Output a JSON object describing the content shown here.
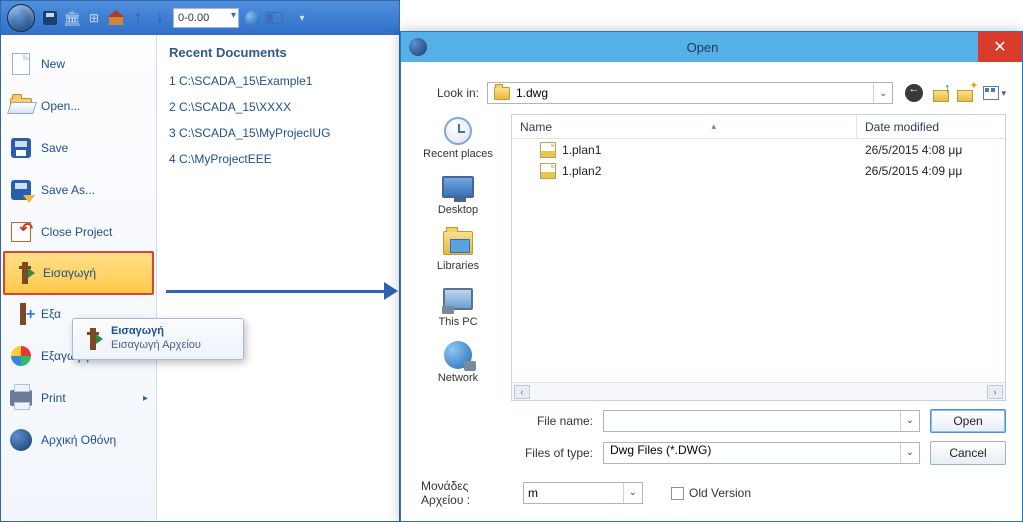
{
  "qat": {
    "combo_value": "0-0.00"
  },
  "menu": {
    "new": "New",
    "open": "Open...",
    "save": "Save",
    "save_as": "Save As...",
    "close_project": "Close Project",
    "import": "Εισαγωγή",
    "export": "Εξα",
    "export_scada": "Εξαγωγή Scadafw",
    "print": "Print",
    "home": "Αρχική Οθόνη"
  },
  "recent": {
    "title": "Recent Documents",
    "items": [
      {
        "idx": "1",
        "path": "C:\\SCADA_15\\Example1"
      },
      {
        "idx": "2",
        "path": "C:\\SCADA_15\\XXXX"
      },
      {
        "idx": "3",
        "path": "C:\\SCADA_15\\MyProjecIUG"
      },
      {
        "idx": "4",
        "path": "C:\\MyProjectEEE"
      }
    ]
  },
  "tooltip": {
    "title": "Εισαγωγή",
    "desc": "Εισαγωγή Αρχείου"
  },
  "dialog": {
    "title": "Open",
    "look_in_label": "Look in:",
    "look_in_value": "1.dwg",
    "places": {
      "recent": "Recent places",
      "desktop": "Desktop",
      "libraries": "Libraries",
      "thispc": "This PC",
      "network": "Network"
    },
    "headers": {
      "name": "Name",
      "date": "Date modified"
    },
    "files": [
      {
        "name": "1.plan1",
        "date": "26/5/2015 4:08 μμ"
      },
      {
        "name": "1.plan2",
        "date": "26/5/2015 4:09 μμ"
      }
    ],
    "filename_label": "File name:",
    "filename_value": "",
    "filetype_label": "Files of type:",
    "filetype_value": "Dwg Files (*.DWG)",
    "units_label": "Μονάδες Αρχείου :",
    "units_value": "m",
    "old_version": "Old Version",
    "open_btn": "Open",
    "cancel_btn": "Cancel"
  }
}
